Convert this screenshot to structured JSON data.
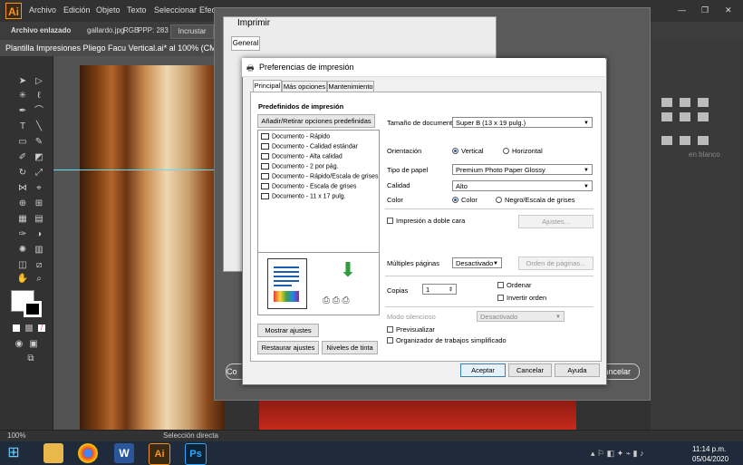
{
  "app": {
    "logo": "Ai",
    "menus": [
      "Archivo",
      "Edición",
      "Objeto",
      "Texto",
      "Seleccionar",
      "Efec"
    ],
    "window_controls": [
      "—",
      "❐",
      "✕"
    ]
  },
  "control_bar": {
    "linked_file": "Archivo enlazado",
    "filename": "gallardo.jpg",
    "color_mode": "RGB",
    "ppp": "PPP: 283",
    "embed_button": "Incrustar"
  },
  "document_tab": {
    "title": "Plantilla Impresiones Pliego Facu Vertical.ai* al 100% (CMYK/Previsu"
  },
  "status_bar": {
    "zoom": "100%",
    "tool": "Selección directa"
  },
  "right_panel": {
    "blanco_label": "en blanco"
  },
  "imprimir_dialog": {
    "title": "Imprimir",
    "tab_general": "General",
    "cancel_button": "Cancelar",
    "co_button": "Co"
  },
  "prefs_dialog": {
    "title": "Preferencias de impresión",
    "tabs": [
      "Principal",
      "Más opciones",
      "Mantenimiento"
    ],
    "presets_heading": "Predefinidos de impresión",
    "add_remove_button": "Añadir/Retirar opciones predefinidas",
    "presets": [
      "Documento - Rápido",
      "Documento - Calidad estándar",
      "Documento - Alta calidad",
      "Documento - 2 por pág.",
      "Documento - Rápido/Escala de grises",
      "Documento - Escala de grises",
      "Documento - 11 x 17 pulg."
    ],
    "show_settings_button": "Mostrar ajustes",
    "restore_button": "Restaurar ajustes",
    "ink_levels_button": "Niveles de tinta",
    "doc_size_label": "Tamaño de documento",
    "doc_size_value": "Super B (13 x 19 pulg.)",
    "orientation_label": "Orientación",
    "orientation_vertical": "Vertical",
    "orientation_horizontal": "Horizontal",
    "paper_type_label": "Tipo de papel",
    "paper_type_value": "Premium Photo Paper Glossy",
    "quality_label": "Calidad",
    "quality_value": "Alto",
    "color_label": "Color",
    "color_option": "Color",
    "grayscale_option": "Negro/Escala de grises",
    "duplex_label": "Impresión a doble cara",
    "duplex_settings_button": "Ajustes...",
    "multipage_label": "Múltiples páginas",
    "multipage_value": "Desactivado",
    "page_order_button": "Orden de páginas...",
    "copies_label": "Copias",
    "copies_value": "1",
    "collate_label": "Ordenar",
    "reverse_order_label": "Invertir orden",
    "quiet_mode_label": "Modo silencioso",
    "quiet_mode_value": "Desactivado",
    "preview_label": "Previsualizar",
    "job_arranger_label": "Organizador de trabajos simplificado",
    "ok_button": "Aceptar",
    "cancel_button": "Cancelar",
    "help_button": "Ayuda"
  },
  "taskbar": {
    "time": "11:14 p.m.",
    "date": "05/04/2020",
    "apps": [
      "explorer-icon",
      "chrome-icon",
      "word-icon",
      "illustrator-icon",
      "photoshop-icon"
    ],
    "ai_label": "Ai",
    "ps_label": "Ps",
    "word_label": "W"
  }
}
